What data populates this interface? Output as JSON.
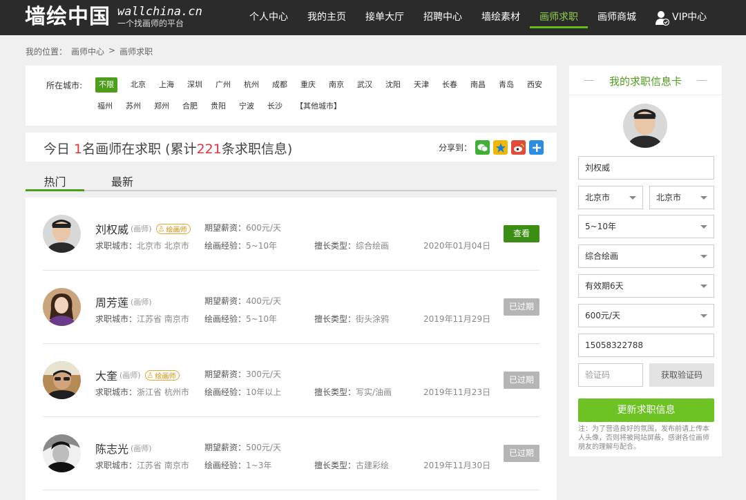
{
  "header": {
    "logo_text": "墙绘中国",
    "logo_domain": "wallchina.cn",
    "logo_slogan": "一个找画师的平台",
    "nav": [
      {
        "label": "个人中心"
      },
      {
        "label": "我的主页"
      },
      {
        "label": "接单大厅"
      },
      {
        "label": "招聘中心"
      },
      {
        "label": "墙绘素材"
      },
      {
        "label": "画师求职",
        "active": true
      },
      {
        "label": "画师商城"
      }
    ],
    "vip_label": "VIP中心",
    "accent_color": "#69b91e"
  },
  "breadcrumb": {
    "prefix": "我的位置：",
    "items": [
      "画师中心",
      "画师求职"
    ],
    "separator": ">"
  },
  "city_filter": {
    "label": "所在城市:",
    "row1": [
      "不限",
      "北京",
      "上海",
      "深圳",
      "广州",
      "杭州",
      "成都",
      "重庆",
      "南京",
      "武汉",
      "沈阳",
      "天津",
      "长春",
      "南昌",
      "青岛",
      "西安"
    ],
    "row2": [
      "福州",
      "苏州",
      "郑州",
      "合肥",
      "贵阳",
      "宁波",
      "长沙",
      "【其他城市】"
    ],
    "selected": "不限"
  },
  "today": {
    "prefix": "今日 ",
    "count": "1",
    "middle": "名画师在求职 (累计",
    "total": "221",
    "suffix": "条求职信息)",
    "share_label": "分享到："
  },
  "tabs": [
    {
      "label": "热门",
      "active": true
    },
    {
      "label": "最新"
    }
  ],
  "listings": [
    {
      "name": "刘权威",
      "role": "(画师)",
      "badge": "绘画师",
      "salary_label": "期望薪资：",
      "salary": "600元/天",
      "city_label": "求职城市：",
      "city": "北京市 北京市",
      "exp_label": "绘画经验：",
      "exp": "5~10年",
      "skill_label": "擅长类型：",
      "skill": "综合绘画",
      "date": "2020年01月04日",
      "action": "查看",
      "expired": false
    },
    {
      "name": "周芳莲",
      "role": "(画师)",
      "badge": "",
      "salary_label": "期望薪资：",
      "salary": "400元/天",
      "city_label": "求职城市：",
      "city": "江苏省 南京市",
      "exp_label": "绘画经验：",
      "exp": "5~10年",
      "skill_label": "擅长类型：",
      "skill": "街头涂鸦",
      "date": "2019年11月29日",
      "action": "已过期",
      "expired": true
    },
    {
      "name": "大奎",
      "role": "(画师)",
      "badge": "绘画师",
      "salary_label": "期望薪资：",
      "salary": "300元/天",
      "city_label": "求职城市：",
      "city": "浙江省 杭州市",
      "exp_label": "绘画经验：",
      "exp": "10年以上",
      "skill_label": "擅长类型：",
      "skill": "写实/油画",
      "date": "2019年11月23日",
      "action": "已过期",
      "expired": true
    },
    {
      "name": "陈志光",
      "role": "(画师)",
      "badge": "",
      "salary_label": "期望薪资：",
      "salary": "500元/天",
      "city_label": "求职城市：",
      "city": "江苏省 南京市",
      "exp_label": "绘画经验：",
      "exp": "1~3年",
      "skill_label": "擅长类型：",
      "skill": "古建彩绘",
      "date": "2019年11月30日",
      "action": "已过期",
      "expired": true
    }
  ],
  "card": {
    "title": "我的求职信息卡",
    "name_value": "刘权威",
    "province": "北京市",
    "city": "北京市",
    "experience": "5~10年",
    "skill": "综合绘画",
    "validity": "有效期6天",
    "salary": "600元/天",
    "phone": "15058322788",
    "captcha_placeholder": "验证码",
    "get_code_label": "获取验证码",
    "update_label": "更新求职信息",
    "note": "注：为了营造良好的氛围，发布前请上传本人头像，否则将被网站屏蔽，感谢各位画师朋友的理解与配合。"
  }
}
